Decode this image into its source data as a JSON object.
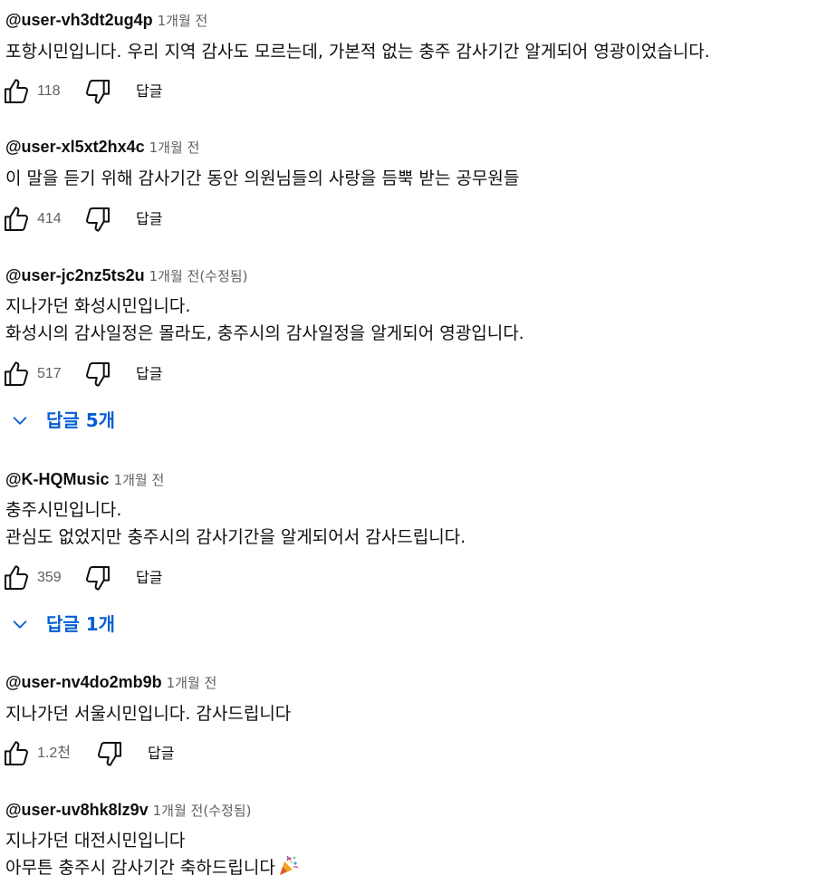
{
  "comments": [
    {
      "author": "@user-vh3dt2ug4p",
      "time": "1개월 전",
      "lines": [
        "포항시민입니다. 우리 지역 감사도 모르는데, 가본적 없는 충주 감사기간 알게되어 영광이었습니다."
      ],
      "likes": "118",
      "reply_label": "답글"
    },
    {
      "author": "@user-xl5xt2hx4c",
      "time": "1개월 전",
      "lines": [
        "이 말을 듣기 위해 감사기간 동안 의원님들의 사랑을 듬뿍 받는 공무원들"
      ],
      "likes": "414",
      "reply_label": "답글"
    },
    {
      "author": "@user-jc2nz5ts2u",
      "time": "1개월 전(수정됨)",
      "lines": [
        "지나가던 화성시민입니다.",
        "화성시의 감사일정은 몰라도, 충주시의 감사일정을 알게되어 영광입니다."
      ],
      "likes": "517",
      "reply_label": "답글",
      "replies_toggle": "답글 5개"
    },
    {
      "author": "@K-HQMusic",
      "time": "1개월 전",
      "lines": [
        "충주시민입니다.",
        "관심도 없었지만 충주시의 감사기간을 알게되어서 감사드립니다."
      ],
      "likes": "359",
      "reply_label": "답글",
      "replies_toggle": "답글 1개"
    },
    {
      "author": "@user-nv4do2mb9b",
      "time": "1개월 전",
      "lines": [
        "지나가던 서울시민입니다. 감사드립니다"
      ],
      "likes": "1.2천",
      "reply_label": "답글"
    },
    {
      "author": "@user-uv8hk8lz9v",
      "time": "1개월 전(수정됨)",
      "lines": [
        "지나가던 대전시민입니다",
        "아무튼 충주시 감사기간 축하드립니다"
      ],
      "emoji": "party-popper-icon"
    }
  ],
  "colors": {
    "text": "#0f0f0f",
    "secondary": "#606060",
    "link": "#065fd4"
  }
}
